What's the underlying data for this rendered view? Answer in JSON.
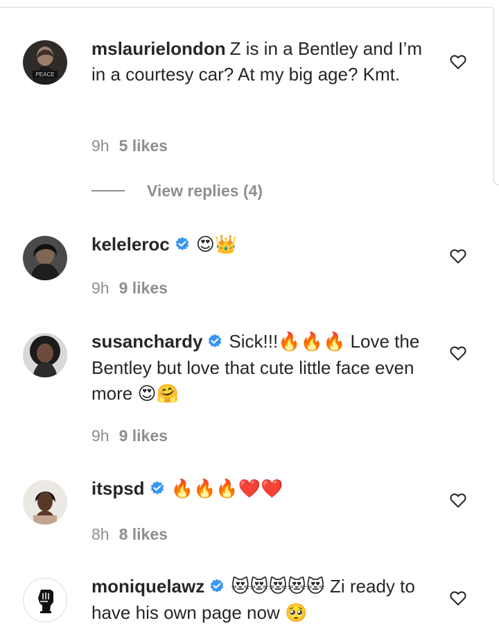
{
  "comments": [
    {
      "username": "mslaurielondon",
      "text": "Z is in a Bentley and I’m in a courtesy car? At my big age? Kmt.",
      "time": "9h",
      "likes": "5 likes",
      "verified": false,
      "avatar_text": "PEACE",
      "view_replies": "View replies (4)"
    },
    {
      "username": "keleleroc",
      "text": "",
      "emoji": "😍👑",
      "time": "9h",
      "likes": "9 likes",
      "verified": true
    },
    {
      "username": "susanchardy",
      "text_before_emoji": "Sick!!!",
      "emoji_mid": "🔥🔥🔥",
      "text_after_emoji": " Love the Bentley but love that cute little face even more ",
      "emoji_end": "😍🤗",
      "time": "9h",
      "likes": "9 likes",
      "verified": true
    },
    {
      "username": "itspsd",
      "emoji": "🔥🔥🔥❤️❤️",
      "time": "8h",
      "likes": "8 likes",
      "verified": true
    },
    {
      "username": "moniquelawz",
      "emoji": "😻😻😻😻😻",
      "text": " Zi ready to have his own page now ",
      "emoji_end": "🥺",
      "verified": true
    }
  ],
  "icons": {
    "verified_color": "#3897f0",
    "heart_color": "#262626"
  }
}
